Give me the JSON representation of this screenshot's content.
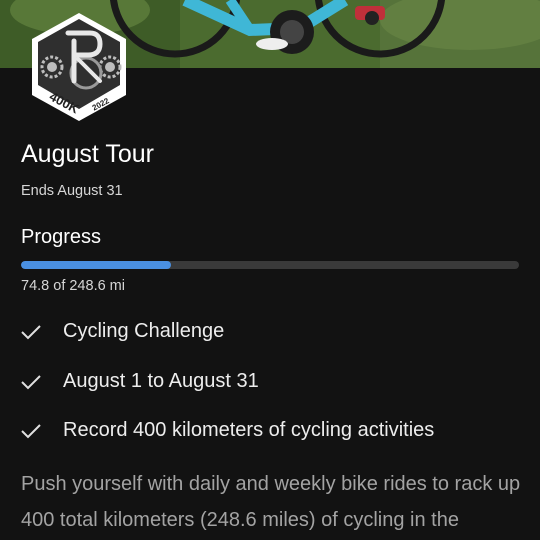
{
  "badge": {
    "label": "400K",
    "year": "2022",
    "icon": "cycling-challenge-badge-icon"
  },
  "challenge": {
    "title": "August Tour",
    "ends": "Ends August 31"
  },
  "progress": {
    "heading": "Progress",
    "current": 74.8,
    "goal": 248.6,
    "fraction": 0.301,
    "text": "74.8 of 248.6 mi",
    "bar_color": "#4a90e2"
  },
  "details": [
    {
      "icon": "checkmark-icon",
      "text": "Cycling Challenge"
    },
    {
      "icon": "checkmark-icon",
      "text": "August 1 to August 31"
    },
    {
      "icon": "checkmark-icon",
      "text": "Record 400 kilometers of cycling activities"
    }
  ],
  "description": "Push yourself with daily and weekly bike rides to rack up 400 total kilometers (248.6 miles) of cycling in the"
}
